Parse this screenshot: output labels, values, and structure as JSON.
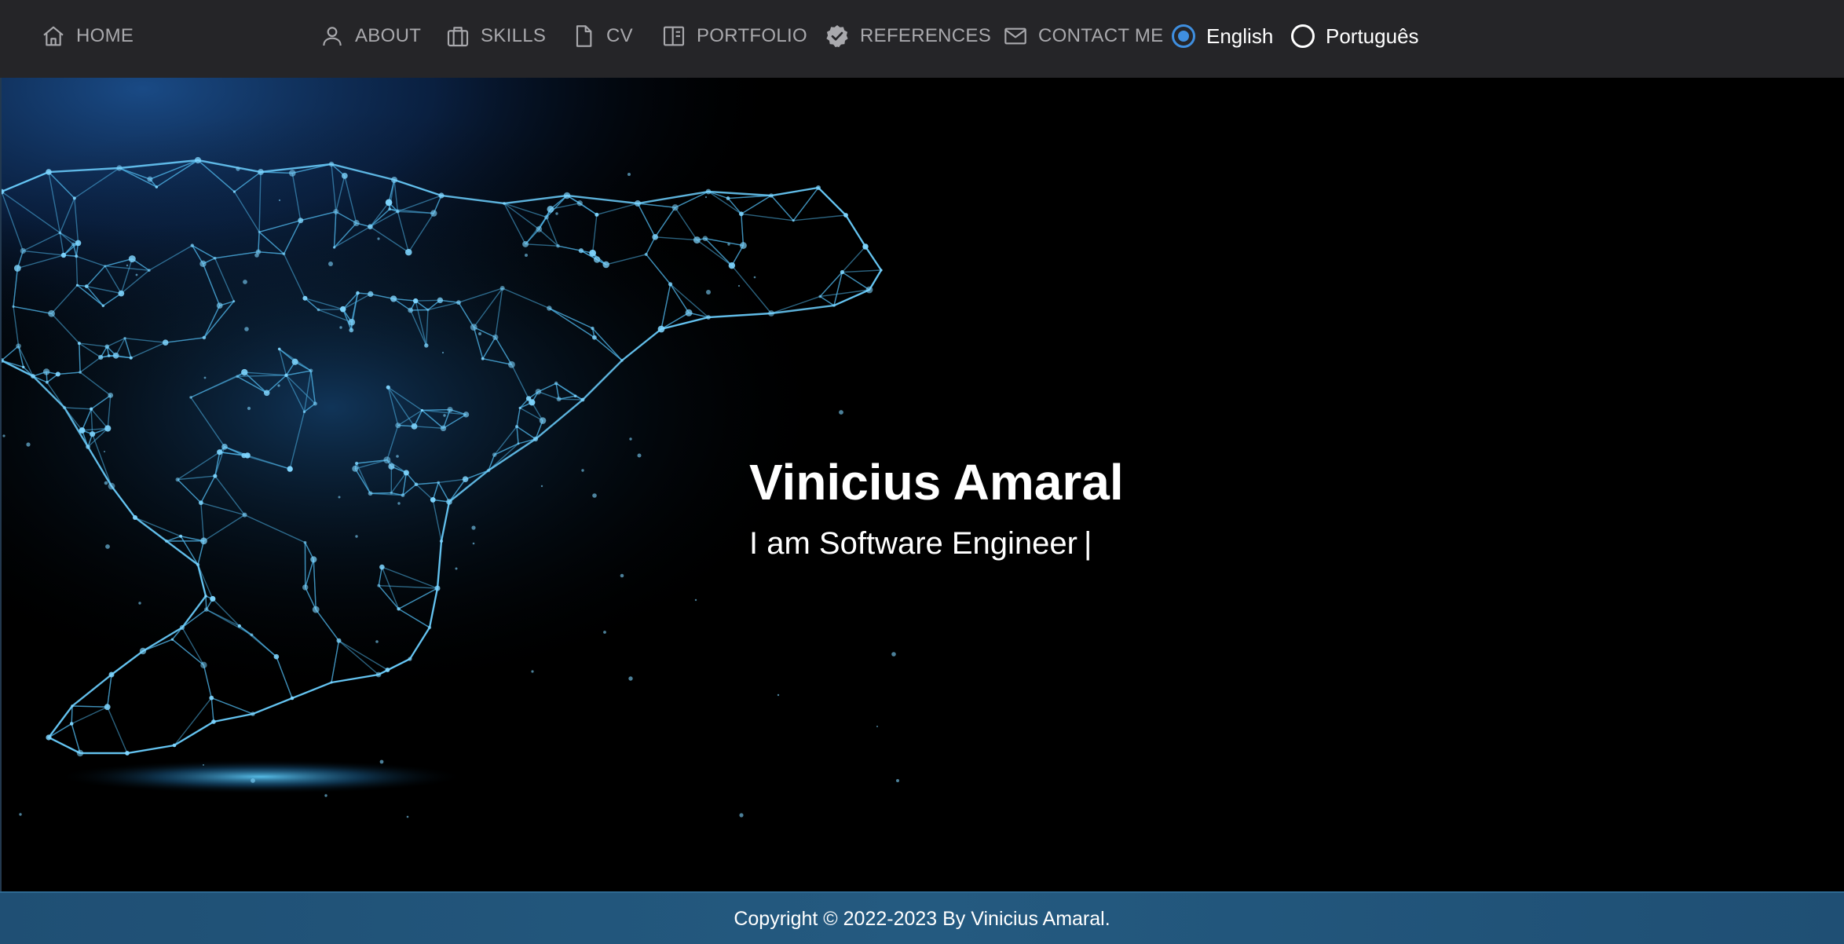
{
  "nav": {
    "items": [
      {
        "label": "HOME",
        "icon": "home-icon"
      },
      {
        "label": "ABOUT",
        "icon": "user-icon"
      },
      {
        "label": "SKILLS",
        "icon": "briefcase-icon"
      },
      {
        "label": "CV",
        "icon": "file-icon"
      },
      {
        "label": "PORTFOLIO",
        "icon": "columns-icon"
      },
      {
        "label": "REFERENCES",
        "icon": "verified-badge-icon"
      },
      {
        "label": "CONTACT ME",
        "icon": "mail-icon"
      }
    ],
    "languages": [
      {
        "label": "English",
        "selected": true
      },
      {
        "label": "Português",
        "selected": false
      }
    ],
    "colors": {
      "text": "#a9a9ad",
      "background": "#252528",
      "accent": "#3f8fe0"
    }
  },
  "hero": {
    "name": "Vinicius Amaral",
    "tagline": "I am Software Engineer",
    "cursor": "|",
    "image": "cheetah-network-illustration"
  },
  "footer": {
    "text": "Copyright © 2022-2023 By Vinicius Amaral."
  }
}
